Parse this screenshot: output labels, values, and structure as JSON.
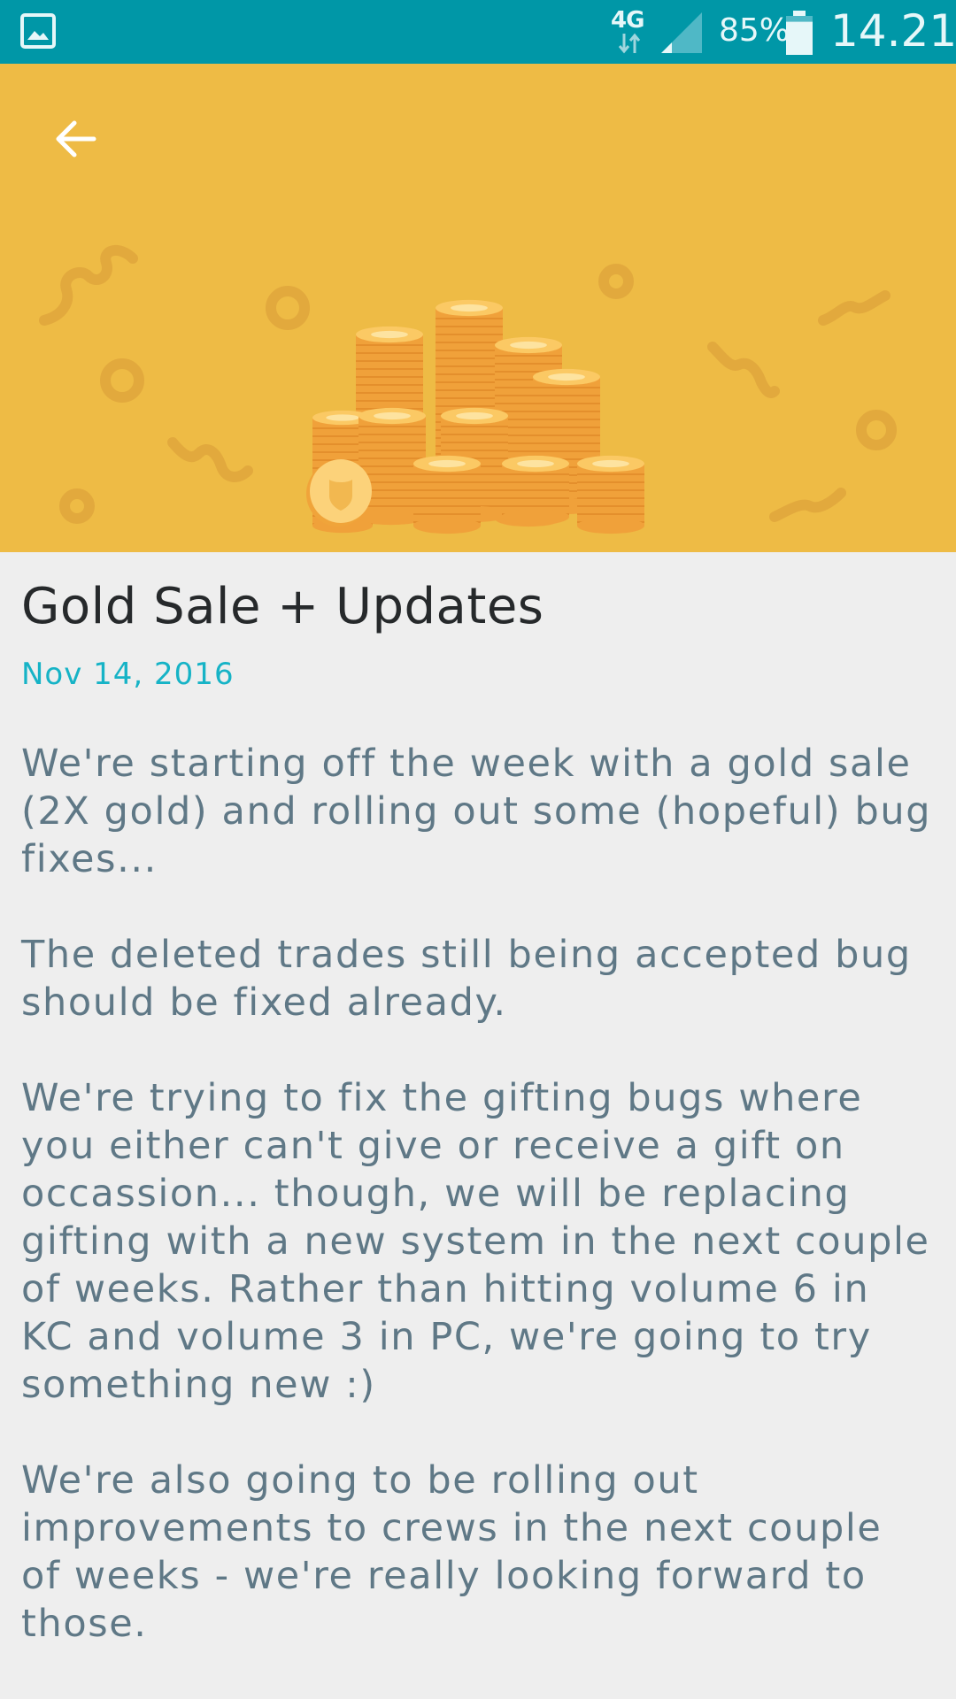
{
  "status_bar": {
    "network_type": "4G",
    "battery_percent": "85%",
    "battery_level": 0.85,
    "time": "14.21",
    "notification_icon": "gallery-icon",
    "signal_icon": "signal-icon",
    "battery_icon": "battery-icon",
    "background_color": "#0097a7"
  },
  "header": {
    "back_icon": "arrow-back-icon",
    "illustration": "gold-coin-stacks",
    "background_color": "#eebb45"
  },
  "article": {
    "title": "Gold Sale + Updates",
    "date": "Nov 14, 2016",
    "date_color": "#16b3c6",
    "paragraphs": [
      "We're starting off the week with a gold sale (2X gold) and rolling out some (hopeful) bug fixes...",
      "The deleted trades still being accepted bug should be fixed already.",
      "We're trying to fix the gifting bugs where you either can't give or receive a gift on occassion... though, we will be replacing gifting with a new system in the next couple of weeks. Rather than hitting volume 6 in KC and volume 3 in PC, we're going to try something new :)",
      "We're also going to be rolling out improvements to crews in the next couple of weeks - we're really looking forward to those."
    ]
  }
}
